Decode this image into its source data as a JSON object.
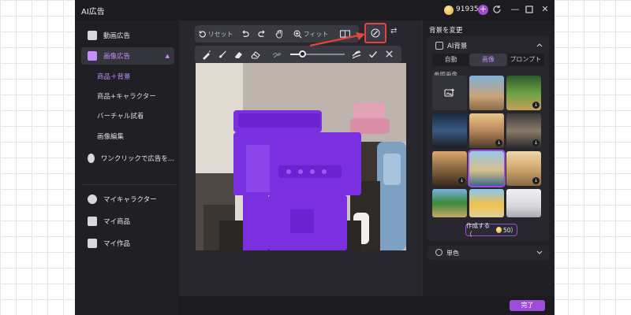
{
  "window": {
    "title": "AI広告",
    "credits": "919358"
  },
  "sidebar": {
    "items": [
      {
        "label": "動画広告"
      },
      {
        "label": "画像広告"
      },
      {
        "label": "ワンクリックで広告を..."
      },
      {
        "label": "マイキャラクター"
      },
      {
        "label": "マイ商品"
      },
      {
        "label": "マイ作品"
      }
    ],
    "sub_items": [
      {
        "label": "商品＋背景"
      },
      {
        "label": "商品+キャラクター"
      },
      {
        "label": "バーチャル試着"
      },
      {
        "label": "画像編集"
      }
    ]
  },
  "toolbar": {
    "reset_label": "リセット",
    "fit_label": "フィット"
  },
  "panel": {
    "title": "背景を変更",
    "section_title": "AI背景",
    "tabs": [
      "自動",
      "画像",
      "プロンプト"
    ],
    "active_tab": "画像",
    "reference_label": "参照画像",
    "create_label": "作成する（",
    "create_cost": "50）",
    "solid_color_label": "単色"
  },
  "footer": {
    "done_label": "完了"
  },
  "colors": {
    "accent": "#9d4bd8",
    "highlight": "#e0443d",
    "mask": "#7a2fe0"
  }
}
